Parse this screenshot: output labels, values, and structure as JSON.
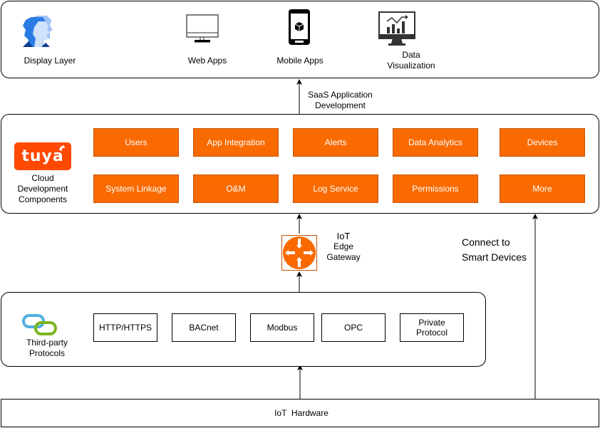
{
  "display_layer": {
    "label": "Display Layer",
    "items": [
      {
        "label": "Web Apps",
        "icon": "monitor-icon"
      },
      {
        "label": "Mobile Apps",
        "icon": "smartphone-icon"
      },
      {
        "label_line1": "Data",
        "label_line2": "Visualization",
        "icon": "data-visualization-icon"
      }
    ]
  },
  "saas_arrow": {
    "line1": "SaaS Application",
    "line2": "Development"
  },
  "cloud_layer": {
    "logo_text": "tuya",
    "label_line1": "Cloud",
    "label_line2": "Development",
    "label_line3": "Components",
    "row1": [
      "Users",
      "App Integration",
      "Alerts",
      "Data Analytics",
      "Devices"
    ],
    "row2": [
      "System Linkage",
      "O&M",
      "Log Service",
      "Permissions",
      "More"
    ]
  },
  "gateway": {
    "line1": "IoT",
    "line2": "Edge",
    "line3": "Gateway"
  },
  "smart_devices": {
    "line1": "Connect to",
    "line2": "Smart Devices"
  },
  "protocol_layer": {
    "label_line1": "Third-party",
    "label_line2": "Protocols",
    "protocols": [
      "HTTP/HTTPS",
      "BACnet",
      "Modbus",
      "OPC"
    ],
    "private_line1": "Private",
    "private_line2": "Protocol"
  },
  "hardware": {
    "label": "IoT  Hardware"
  },
  "colors": {
    "accent": "#f96a00",
    "accent_border": "#c55400",
    "link_blue": "#4fb0df",
    "link_green": "#7ab51d"
  }
}
